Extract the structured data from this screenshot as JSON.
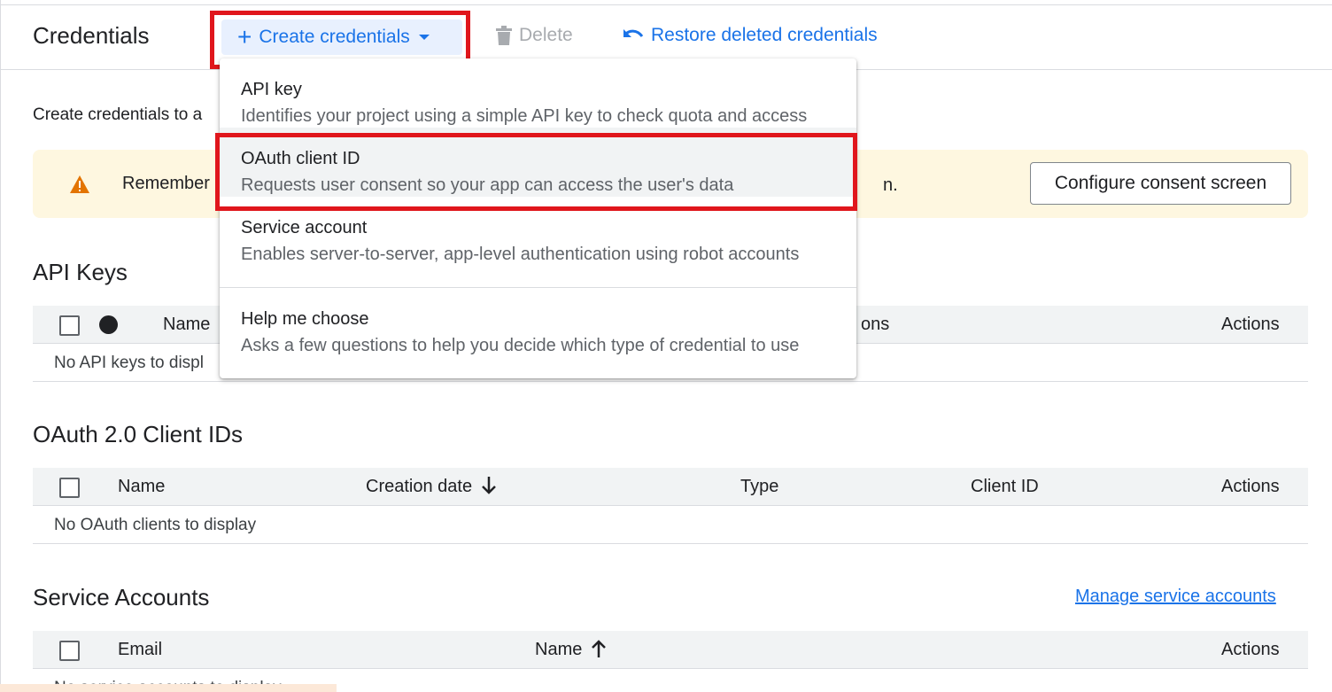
{
  "header": {
    "title": "Credentials",
    "create_label": "Create credentials",
    "delete_label": "Delete",
    "restore_label": "Restore deleted credentials"
  },
  "intro_text": "Create credentials to a",
  "banner": {
    "text": "Remember",
    "text_end": "n.",
    "button_label": "Configure consent screen"
  },
  "api_keys": {
    "title": "API Keys",
    "columns": [
      "Name",
      "ons",
      "Actions"
    ],
    "empty": "No API keys to displ"
  },
  "oauth_clients": {
    "title": "OAuth 2.0 Client IDs",
    "columns": [
      "Name",
      "Creation date",
      "Type",
      "Client ID",
      "Actions"
    ],
    "empty": "No OAuth clients to display"
  },
  "service_accounts": {
    "title": "Service Accounts",
    "manage_link": "Manage service accounts",
    "columns": [
      "Email",
      "Name",
      "Actions"
    ],
    "empty": "No service accounts to display"
  },
  "menu": {
    "items": [
      {
        "title": "API key",
        "desc": "Identifies your project using a simple API key to check quota and access"
      },
      {
        "title": "OAuth client ID",
        "desc": "Requests user consent so your app can access the user's data"
      },
      {
        "title": "Service account",
        "desc": "Enables server-to-server, app-level authentication using robot accounts"
      },
      {
        "title": "Help me choose",
        "desc": "Asks a few questions to help you decide which type of credential to use"
      }
    ]
  },
  "colors": {
    "accent": "#1a73e8",
    "highlight": "#e0161c",
    "banner_bg": "#fef7e0",
    "warning": "#e37400"
  }
}
